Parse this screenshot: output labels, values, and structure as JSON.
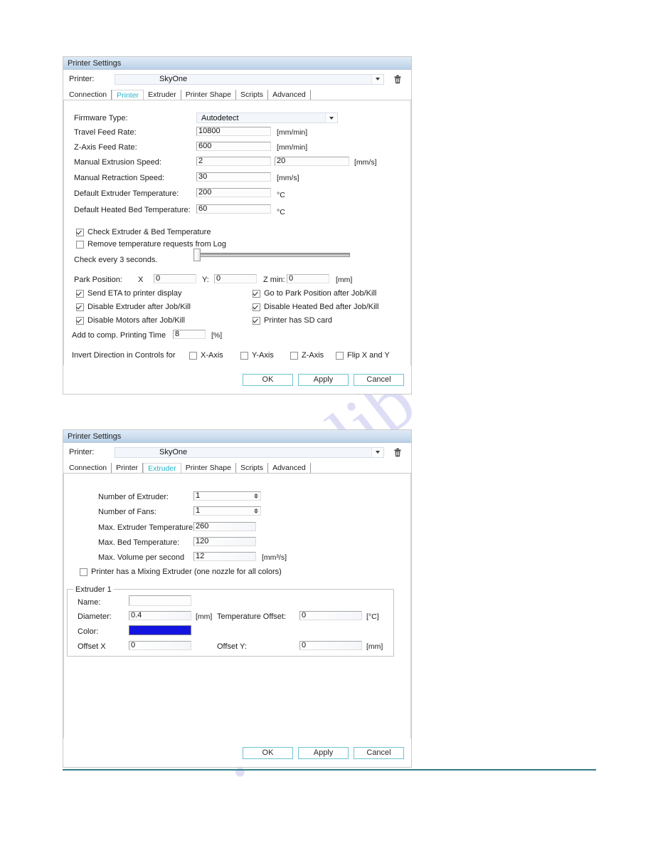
{
  "watermark": {
    "line1": "manualslib",
    "line2": ".com"
  },
  "dialogs": [
    {
      "id": "printer",
      "title": "Printer Settings",
      "printer_label": "Printer:",
      "printer_value": "SkyOne",
      "delete_icon": "trash-icon",
      "tabs": [
        {
          "label": "Connection",
          "active": false
        },
        {
          "label": "Printer",
          "active": true
        },
        {
          "label": "Extruder",
          "active": false
        },
        {
          "label": "Printer Shape",
          "active": false
        },
        {
          "label": "Scripts",
          "active": false
        },
        {
          "label": "Advanced",
          "active": false
        }
      ],
      "fields": {
        "firmware_label": "Firmware Type:",
        "firmware_value": "Autodetect",
        "travel_feed_label": "Travel Feed Rate:",
        "travel_feed_value": "10800",
        "travel_feed_unit": "[mm/min]",
        "z_feed_label": "Z-Axis Feed Rate:",
        "z_feed_value": "600",
        "z_feed_unit": "[mm/min]",
        "manual_extrusion_label": "Manual Extrusion Speed:",
        "manual_extrusion_value1": "2",
        "manual_extrusion_value2": "20",
        "manual_extrusion_unit": "[mm/s]",
        "manual_retraction_label": "Manual Retraction Speed:",
        "manual_retraction_value": "30",
        "manual_retraction_unit": "[mm/s]",
        "default_extruder_temp_label": "Default Extruder Temperature:",
        "default_extruder_temp_value": "200",
        "default_extruder_temp_unit": "°C",
        "default_bed_temp_label": "Default Heated Bed Temperature:",
        "default_bed_temp_value": "60",
        "default_bed_temp_unit": "°C",
        "check_temp_label": "Check Extruder & Bed Temperature",
        "check_temp_checked": true,
        "remove_temp_label": "Remove temperature requests from Log",
        "remove_temp_checked": false,
        "check_every_label": "Check every 3 seconds.",
        "park_position_label": "Park Position:",
        "park_x_label": "X",
        "park_x_value": "0",
        "park_y_label": "Y:",
        "park_y_value": "0",
        "park_z_label": "Z min:",
        "park_z_value": "0",
        "park_unit": "[mm]",
        "send_eta_label": "Send ETA to printer display",
        "send_eta_checked": true,
        "goto_park_label": "Go to Park Position after Job/Kill",
        "goto_park_checked": true,
        "disable_extruder_label": "Disable Extruder after Job/Kill",
        "disable_extruder_checked": true,
        "disable_bed_label": "Disable Heated Bed after Job/Kill",
        "disable_bed_checked": true,
        "disable_motors_label": "Disable Motors after Job/Kill",
        "disable_motors_checked": true,
        "has_sd_label": "Printer has SD card",
        "has_sd_checked": true,
        "add_time_label": "Add to comp. Printing Time",
        "add_time_value": "8",
        "add_time_unit": "[%]",
        "invert_label": "Invert Direction in Controls for",
        "invert_x_label": "X-Axis",
        "invert_x_checked": false,
        "invert_y_label": "Y-Axis",
        "invert_y_checked": false,
        "invert_z_label": "Z-Axis",
        "invert_z_checked": false,
        "flip_xy_label": "Flip X and Y",
        "flip_xy_checked": false
      },
      "buttons": {
        "ok": "OK",
        "apply": "Apply",
        "cancel": "Cancel"
      }
    },
    {
      "id": "extruder",
      "title": "Printer Settings",
      "printer_label": "Printer:",
      "printer_value": "SkyOne",
      "delete_icon": "trash-icon",
      "tabs": [
        {
          "label": "Connection",
          "active": false
        },
        {
          "label": "Printer",
          "active": false
        },
        {
          "label": "Extruder",
          "active": true
        },
        {
          "label": "Printer Shape",
          "active": false
        },
        {
          "label": "Scripts",
          "active": false
        },
        {
          "label": "Advanced",
          "active": false
        }
      ],
      "fields": {
        "num_extruder_label": "Number of Extruder:",
        "num_extruder_value": "1",
        "num_fans_label": "Number of Fans:",
        "num_fans_value": "1",
        "max_extruder_temp_label": "Max. Extruder Temperature:",
        "max_extruder_temp_value": "260",
        "max_bed_temp_label": "Max. Bed Temperature:",
        "max_bed_temp_value": "120",
        "max_volume_label": "Max. Volume per second",
        "max_volume_value": "12",
        "max_volume_unit": "[mm³/s]",
        "mixing_label": "Printer has a Mixing Extruder (one nozzle for all colors)",
        "mixing_checked": false,
        "group_legend": "Extruder 1",
        "name_label": "Name:",
        "name_value": "",
        "diameter_label": "Diameter:",
        "diameter_value": "0.4",
        "diameter_unit": "[mm]",
        "temp_offset_label": "Temperature Offset:",
        "temp_offset_value": "0",
        "temp_offset_unit": "[°C]",
        "color_label": "Color:",
        "color_value": "#1414e0",
        "offset_x_label": "Offset X",
        "offset_x_value": "0",
        "offset_y_label": "Offset Y:",
        "offset_y_value": "0",
        "offset_unit": "[mm]"
      },
      "buttons": {
        "ok": "OK",
        "apply": "Apply",
        "cancel": "Cancel"
      }
    }
  ]
}
